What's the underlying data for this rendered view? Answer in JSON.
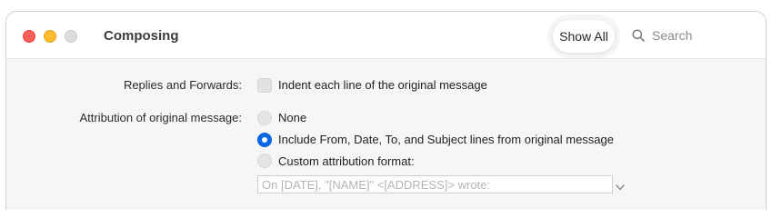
{
  "window": {
    "title": "Composing",
    "show_all_label": "Show All",
    "search_placeholder": "Search"
  },
  "replies": {
    "label": "Replies and Forwards:",
    "indent_label": "Indent each line of the original message",
    "indent_checked": false
  },
  "attribution": {
    "label": "Attribution of original message:",
    "options": [
      {
        "label": "None",
        "selected": false
      },
      {
        "label": "Include From, Date, To, and Subject lines from original message",
        "selected": true
      },
      {
        "label": "Custom attribution format:",
        "selected": false
      }
    ],
    "format_placeholder": "On [DATE], \"[NAME]\" <[ADDRESS]> wrote:"
  },
  "colors": {
    "accent": "#0a67e8",
    "close": "#ff5f57",
    "minimize": "#febc2e",
    "zoom_disabled": "#dcdcdc"
  },
  "icons": [
    "close-icon",
    "minimize-icon",
    "zoom-icon",
    "search-icon",
    "chevron-down-icon"
  ]
}
